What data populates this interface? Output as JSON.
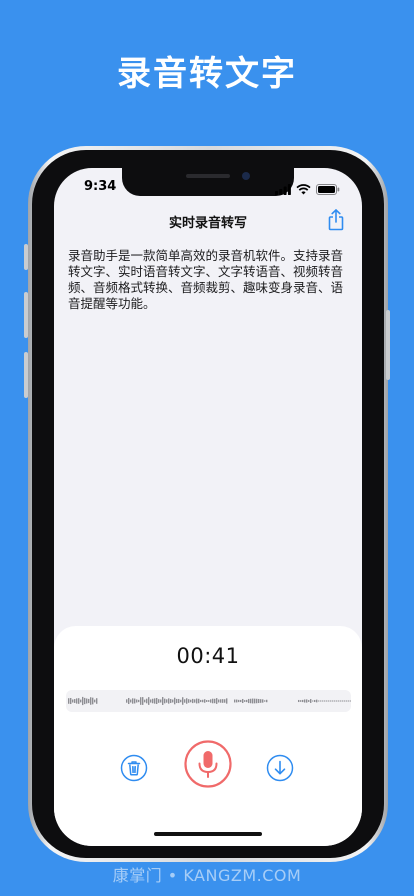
{
  "headline": "录音转文字",
  "status_bar": {
    "time": "9:34"
  },
  "nav": {
    "title": "实时录音转写"
  },
  "content": {
    "text": "录音助手是一款简单高效的录音机软件。支持录音转文字、实时语音转文字、文字转语音、视频转音频、音频格式转换、音频裁剪、趣味变身录音、语音提醒等功能。"
  },
  "recorder": {
    "timer": "00:41"
  },
  "icons": {
    "share": "share-icon",
    "delete": "trash-icon",
    "record": "microphone-icon",
    "save": "download-icon",
    "signal": "signal-icon",
    "wifi": "wifi-icon",
    "battery": "battery-icon"
  },
  "colors": {
    "background": "#3a91ee",
    "accent": "#2f8cf0",
    "record": "#f06a6a"
  },
  "watermark": "康掌门 • KANGZM.COM"
}
